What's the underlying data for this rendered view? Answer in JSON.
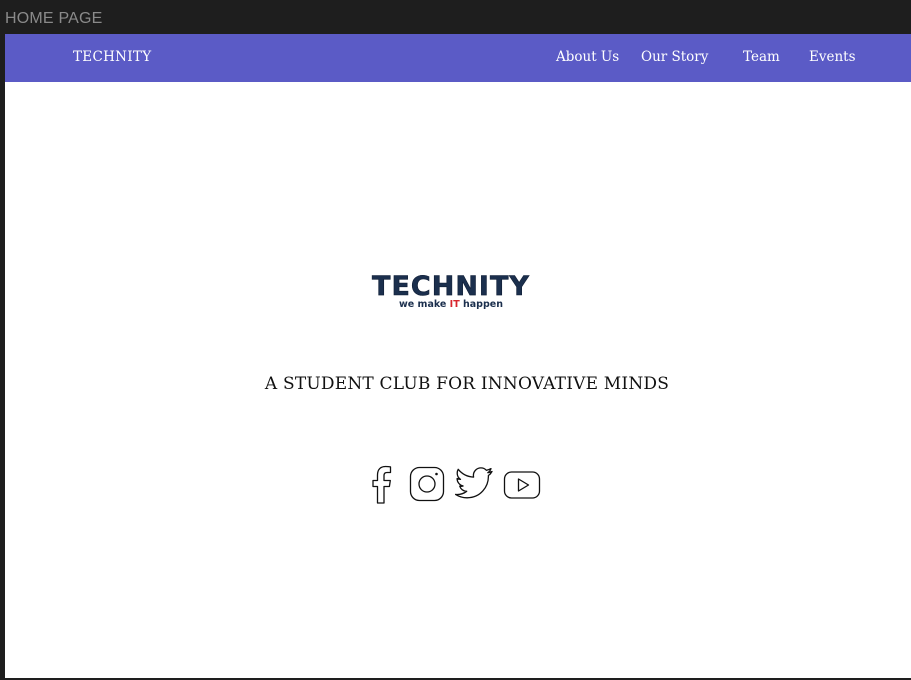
{
  "window": {
    "title": "HOME PAGE"
  },
  "navbar": {
    "brand": "TECHNITY",
    "links": [
      {
        "label": "About Us"
      },
      {
        "label": "Our Story"
      },
      {
        "label": "Team"
      },
      {
        "label": "Events"
      }
    ],
    "background_color": "#5b5bc6"
  },
  "hero": {
    "logo": {
      "wordmark": "TECHNITY",
      "tagline_before": "we make ",
      "tagline_accent": "IT",
      "tagline_after": " happen"
    },
    "headline": "A STUDENT CLUB FOR INNOVATIVE MINDS"
  },
  "social": [
    {
      "icon": "facebook-icon"
    },
    {
      "icon": "instagram-icon"
    },
    {
      "icon": "twitter-icon"
    },
    {
      "icon": "youtube-icon"
    }
  ],
  "colors": {
    "logo_navy": "#1b2f4d",
    "logo_red": "#d8242c"
  }
}
